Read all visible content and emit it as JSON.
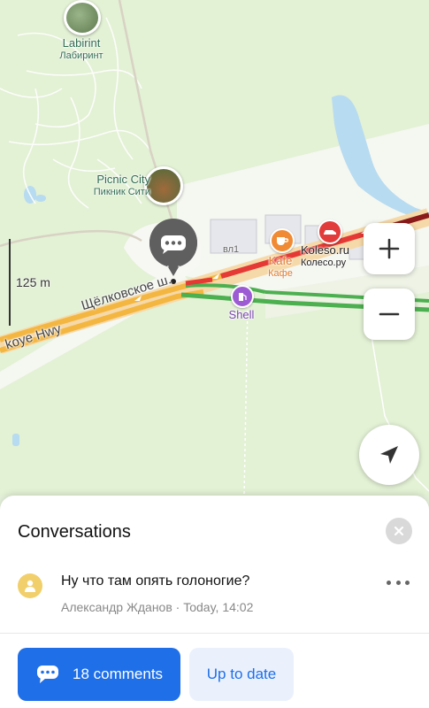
{
  "map": {
    "poi_labirint": {
      "name": "Labirint",
      "name_local": "Лабиринт"
    },
    "poi_picnic": {
      "name": "Picnic City",
      "name_local": "Пикник Сити"
    },
    "building_label": "вл1",
    "cafe": {
      "name": "Kafe",
      "name_local": "Кафе"
    },
    "koleso": {
      "name": "Koleso.ru",
      "name_local": "Колесо.ру"
    },
    "shell": "Shell",
    "road_local": "Щёлковское ш.",
    "road_en": "koye Hwy",
    "scale": "125 m",
    "colors": {
      "traffic_red": "#e53935",
      "traffic_yellow": "#f3b640",
      "traffic_green": "#4caf50",
      "traffic_darkred": "#8b1a1a"
    }
  },
  "controls": {
    "zoom_in_icon": "plus-icon",
    "zoom_out_icon": "minus-icon",
    "locate_icon": "navigation-arrow-icon"
  },
  "sheet": {
    "title": "Conversations",
    "conversation": {
      "text": "Ну что там опять голоногие?",
      "meta": "Александр Жданов · Today, 14:02"
    },
    "comments_button": "18 comments",
    "uptodate_button": "Up to date"
  }
}
